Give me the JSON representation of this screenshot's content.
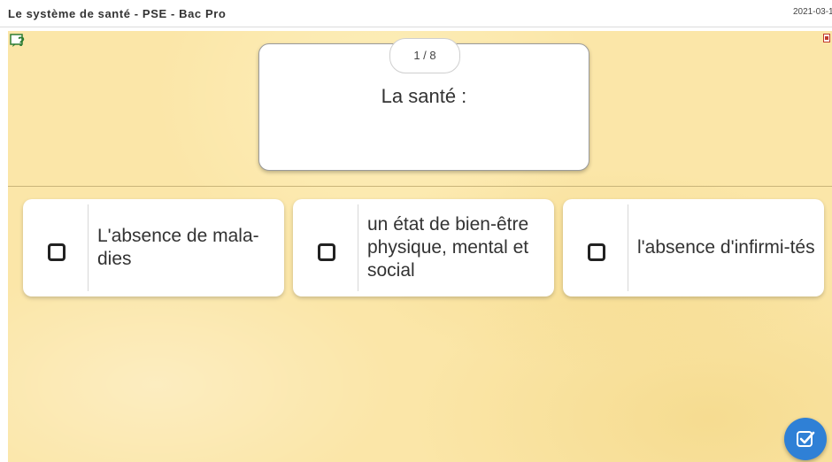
{
  "header": {
    "title": "Le système de santé - PSE - Bac Pro",
    "date": "2021-03-1"
  },
  "quiz": {
    "counter": "1 / 8",
    "question": "La santé :",
    "answers": [
      {
        "label": "L'absence de mala-dies",
        "checked": false
      },
      {
        "label": "un état de bien-être physique, mental et social",
        "checked": false
      },
      {
        "label": "l'absence d'infirmi-tés",
        "checked": false
      }
    ]
  },
  "icons": {
    "help": "help-icon",
    "corner": "close-icon",
    "validate": "check-square-icon"
  },
  "colors": {
    "background": "#fbe6a8",
    "accent": "#2f80d6"
  }
}
